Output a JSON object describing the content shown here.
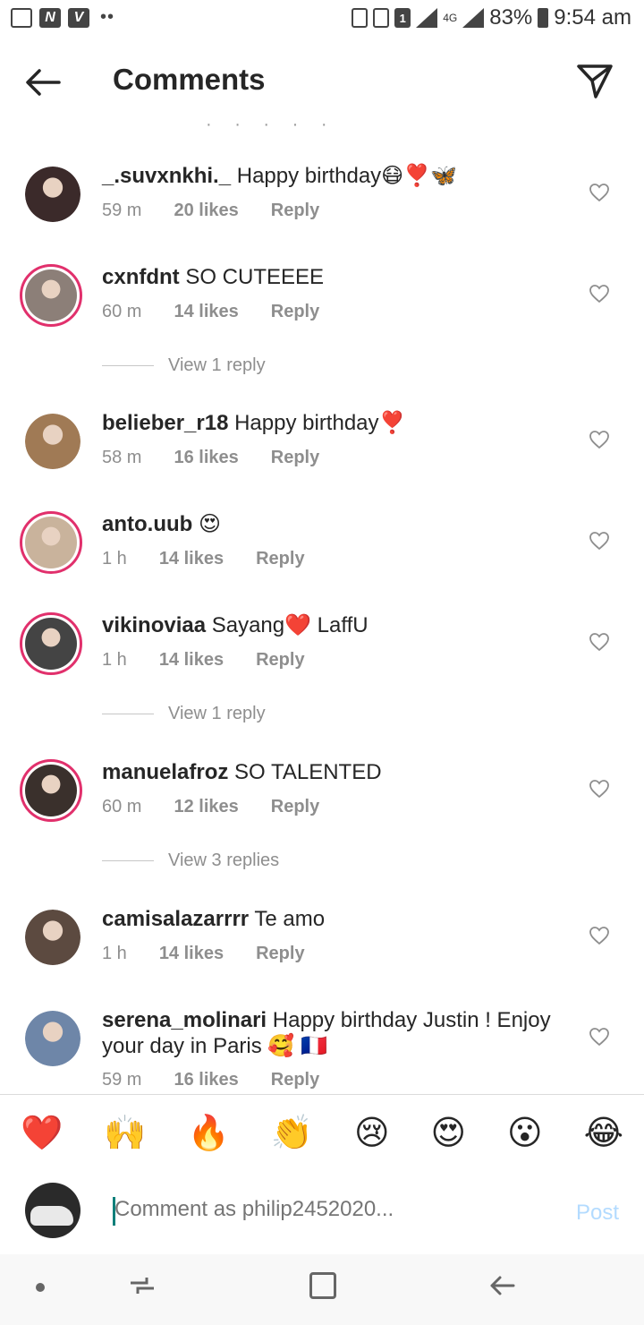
{
  "status_bar": {
    "battery": "83%",
    "time": "9:54 am",
    "notif_icons": [
      "image-icon",
      "n-icon",
      "v-icon"
    ],
    "sim_badge": "1",
    "network": "4G"
  },
  "header": {
    "title": "Comments"
  },
  "comments": [
    {
      "user": "_.suvxnkhi._",
      "text": " Happy birthday😷❣️🦋",
      "time": "59 m",
      "likes": "20 likes",
      "reply": "Reply",
      "ring": false,
      "avatar_color": "#3b2a2a"
    },
    {
      "user": "cxnfdnt",
      "text": " SO CUTEEEE",
      "time": "60 m",
      "likes": "14 likes",
      "reply": "Reply",
      "ring": true,
      "avatar_color": "#8c7f78",
      "view_replies": "View 1 reply"
    },
    {
      "user": "belieber_r18",
      "text": " Happy birthday❣️",
      "time": "58 m",
      "likes": "16 likes",
      "reply": "Reply",
      "ring": false,
      "avatar_color": "#a07a55"
    },
    {
      "user": "anto.uub",
      "text": " 😍",
      "time": "1 h",
      "likes": "14 likes",
      "reply": "Reply",
      "ring": true,
      "avatar_color": "#c9b39c"
    },
    {
      "user": "vikinoviaa",
      "text": " Sayang❤️ LaffU",
      "time": "1 h",
      "likes": "14 likes",
      "reply": "Reply",
      "ring": true,
      "avatar_color": "#444444",
      "view_replies": "View 1 reply"
    },
    {
      "user": "manuelafroz",
      "text": " SO TALENTED",
      "time": "60 m",
      "likes": "12 likes",
      "reply": "Reply",
      "ring": true,
      "avatar_color": "#3a302c",
      "view_replies": "View 3 replies"
    },
    {
      "user": "camisalazarrrr",
      "text": " Te amo",
      "time": "1 h",
      "likes": "14 likes",
      "reply": "Reply",
      "ring": false,
      "avatar_color": "#5c4a40"
    },
    {
      "user": "serena_molinari",
      "text": " Happy birthday Justin ! Enjoy your day in Paris 🥰 🇫🇷",
      "time": "59 m",
      "likes": "16 likes",
      "reply": "Reply",
      "ring": false,
      "avatar_color": "#6e86a8"
    }
  ],
  "emoji_bar": [
    "❤️",
    "🙌",
    "🔥",
    "👏",
    "😢",
    "😍",
    "😮",
    "😂"
  ],
  "composer": {
    "placeholder": "Comment as philip2452020...",
    "post_label": "Post"
  },
  "colors": {
    "ring": "#e1306c",
    "meta": "#8e8e8e",
    "post_disabled": "#b3dbff"
  }
}
